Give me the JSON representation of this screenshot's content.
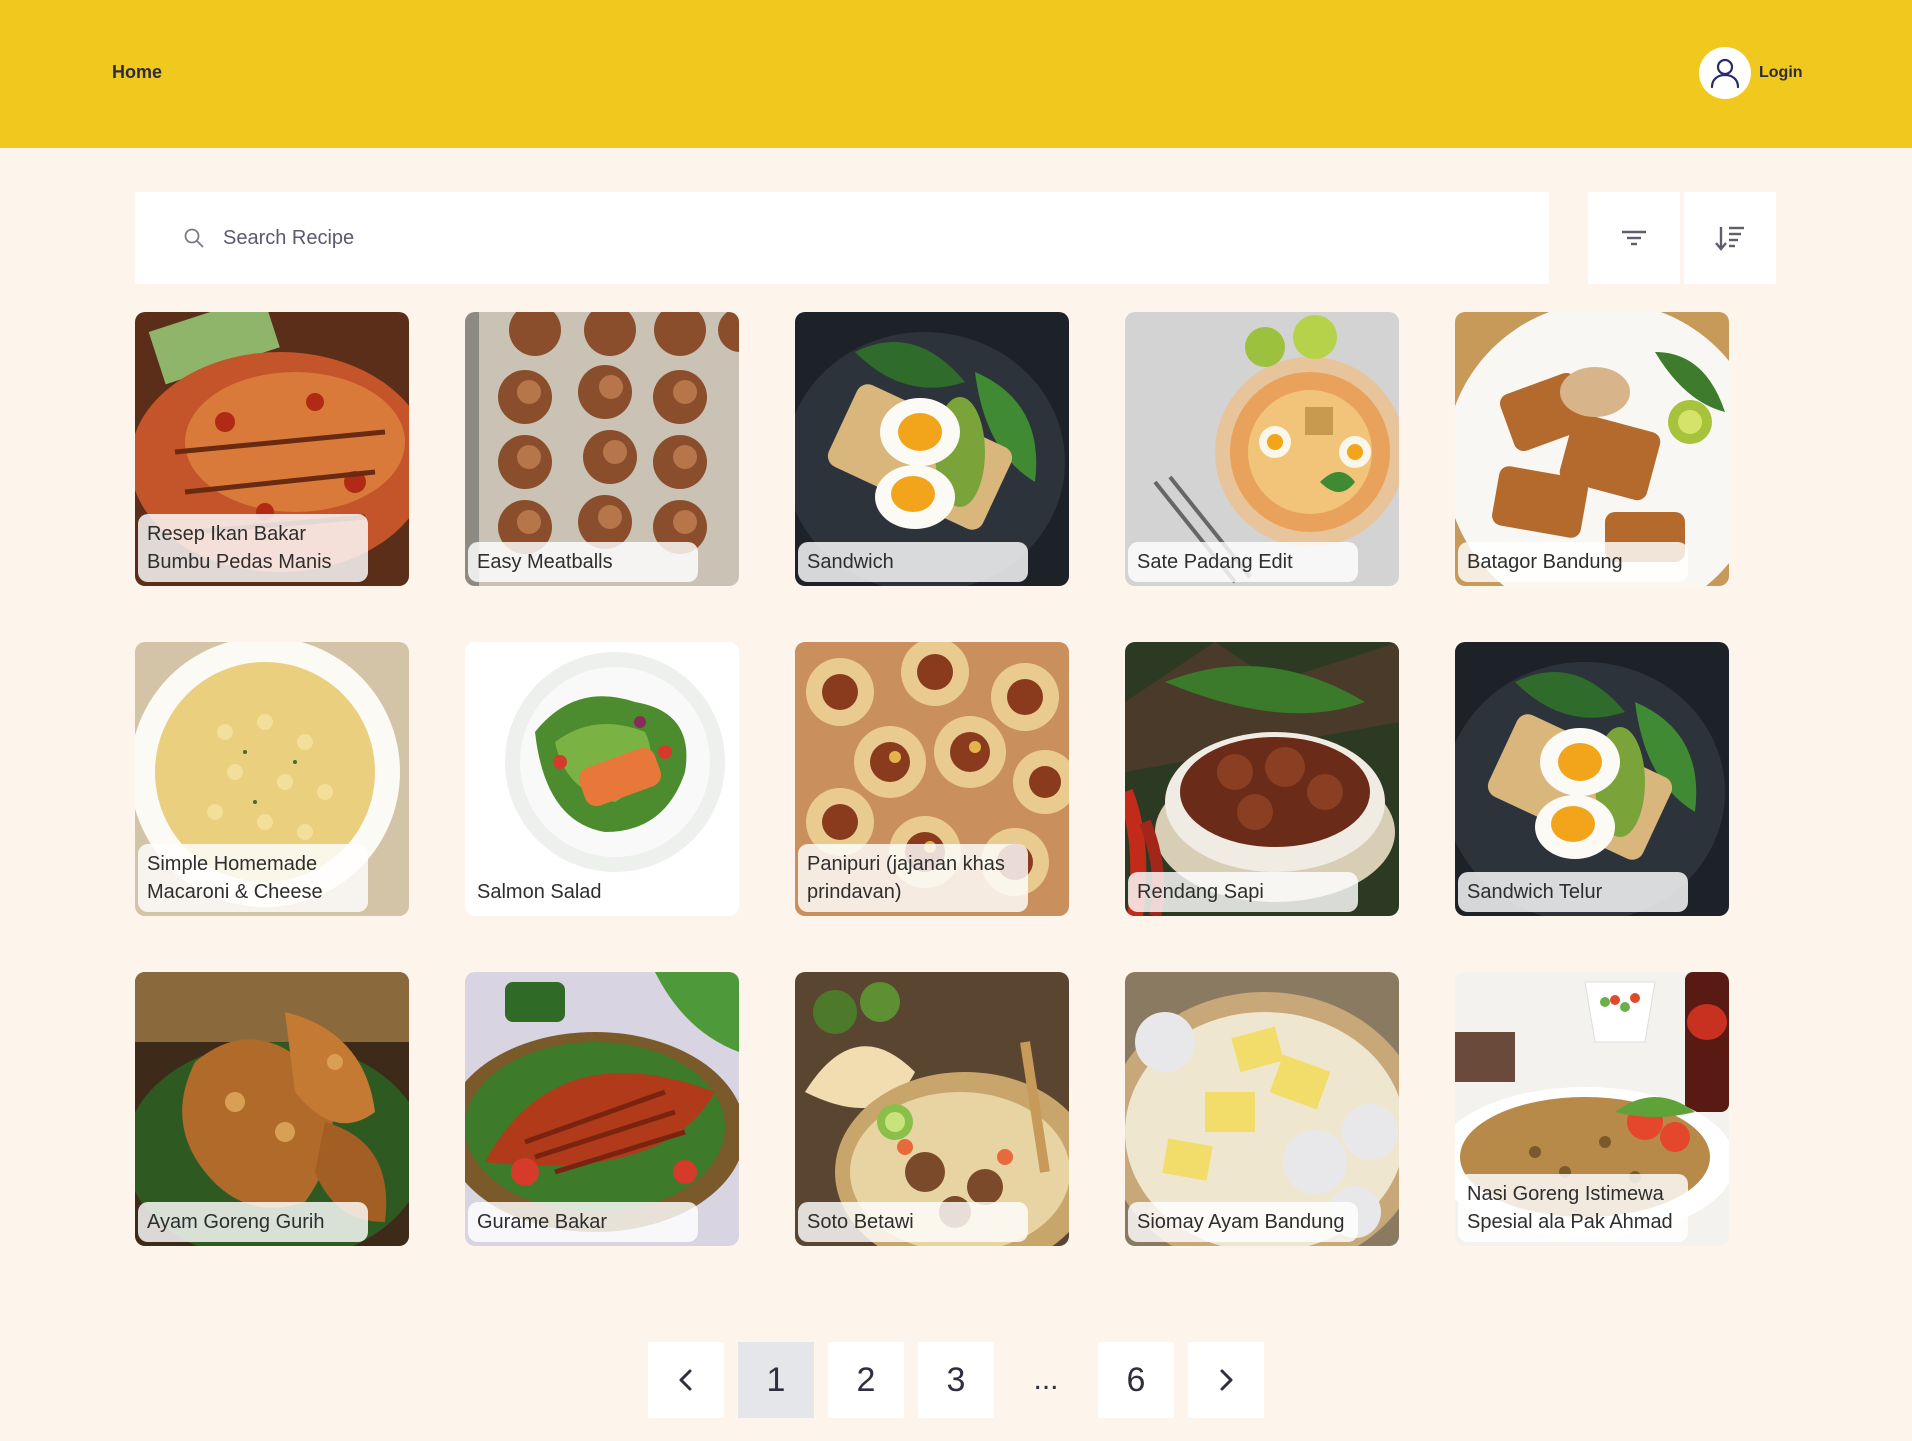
{
  "nav": {
    "home_label": "Home",
    "login_label": "Login"
  },
  "search": {
    "placeholder": "Search Recipe"
  },
  "toolbar": {
    "filter_icon": "filter-icon",
    "sort_icon": "sort-descending-icon"
  },
  "recipes": [
    {
      "title": "Resep Ikan Bakar Bumbu Pedas Manis"
    },
    {
      "title": "Easy Meatballs"
    },
    {
      "title": "Sandwich"
    },
    {
      "title": "Sate Padang Edit"
    },
    {
      "title": "Batagor Bandung"
    },
    {
      "title": "Simple Homemade Macaroni & Cheese"
    },
    {
      "title": "Salmon Salad"
    },
    {
      "title": "Panipuri (jajanan khas prindavan)"
    },
    {
      "title": "Rendang Sapi"
    },
    {
      "title": "Sandwich Telur"
    },
    {
      "title": "Ayam Goreng Gurih"
    },
    {
      "title": "Gurame Bakar"
    },
    {
      "title": "Soto Betawi"
    },
    {
      "title": "Siomay Ayam Bandung"
    },
    {
      "title": "Nasi Goreng Istimewa Spesial ala Pak Ahmad"
    }
  ],
  "pagination": {
    "prev_icon": "chevron-left-icon",
    "next_icon": "chevron-right-icon",
    "pages": [
      "1",
      "2",
      "3",
      "...",
      "6"
    ],
    "current": "1"
  },
  "colors": {
    "header": "#f1c81e",
    "background": "#fdf4ec",
    "active_page": "#e4e6ea"
  }
}
